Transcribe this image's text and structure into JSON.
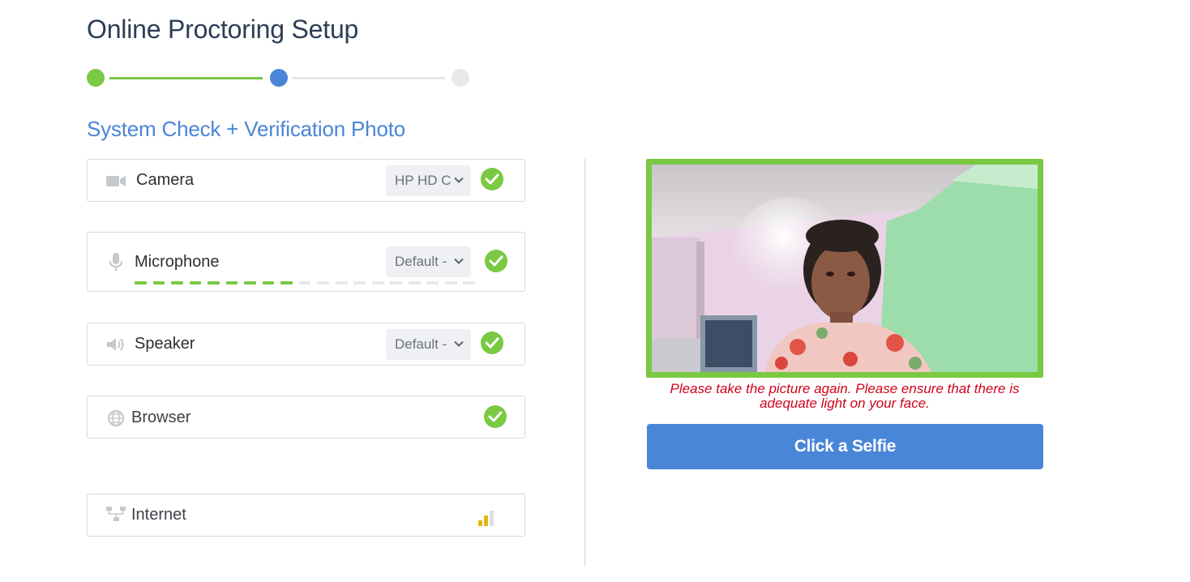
{
  "page": {
    "title": "Online Proctoring Setup",
    "section_title": "System Check + Verification Photo"
  },
  "stepper": {
    "steps": [
      {
        "state": "complete",
        "color": "#7ac943"
      },
      {
        "state": "current",
        "color": "#4a86d8"
      },
      {
        "state": "pending",
        "color": "#e8e8ea"
      }
    ]
  },
  "checks": {
    "camera": {
      "label": "Camera",
      "icon": "video-camera-icon",
      "selected_device": "HP HD C",
      "status": "ok"
    },
    "microphone": {
      "label": "Microphone",
      "icon": "microphone-icon",
      "selected_device": "Default -",
      "status": "ok",
      "level": {
        "active_segments": 9,
        "total_segments": 19
      }
    },
    "speaker": {
      "label": "Speaker",
      "icon": "speaker-icon",
      "selected_device": "Default -",
      "status": "ok"
    },
    "browser": {
      "label": "Browser",
      "icon": "globe-icon",
      "status": "ok"
    },
    "internet": {
      "label": "Internet",
      "icon": "network-icon",
      "signal": {
        "active_bars": 2,
        "total_bars": 3
      }
    }
  },
  "preview": {
    "warning": "Please take the picture again. Please ensure that there is adequate light on your face.",
    "button_label": "Click a Selfie"
  },
  "colors": {
    "accent_blue": "#4a86d8",
    "success_green": "#7ac943",
    "error_red": "#d0021b",
    "signal_yellow": "#e5b50f"
  }
}
